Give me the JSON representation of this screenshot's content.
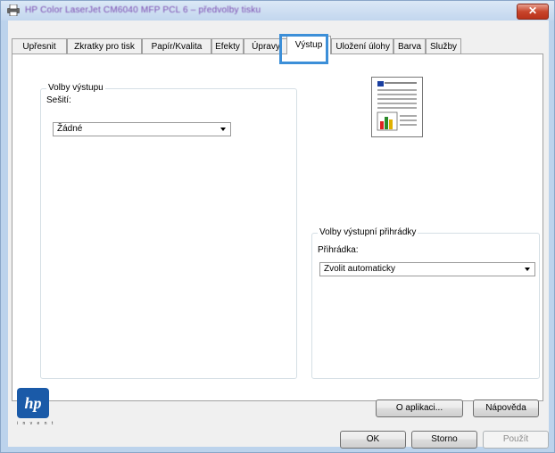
{
  "window": {
    "title": "HP Color LaserJet CM6040 MFP PCL 6 – předvolby tisku",
    "close_glyph": "✕"
  },
  "tabs": [
    {
      "label": "Upřesnit"
    },
    {
      "label": "Zkratky pro tisk"
    },
    {
      "label": "Papír/Kvalita"
    },
    {
      "label": "Efekty"
    },
    {
      "label": "Úpravy"
    },
    {
      "label": "Výstup"
    },
    {
      "label": "Uložení úlohy"
    },
    {
      "label": "Barva"
    },
    {
      "label": "Služby"
    }
  ],
  "active_tab": "Výstup",
  "output_options": {
    "legend": "Volby výstupu",
    "stapler_label": "Sešití:",
    "stapler_value": "Žádné"
  },
  "tray_options": {
    "legend": "Volby výstupní přihrádky",
    "tray_label": "Přihrádka:",
    "tray_value": "Zvolit automaticky"
  },
  "logo": {
    "tagline": "i n v e n t"
  },
  "buttons": {
    "about": "O aplikaci...",
    "help": "Nápověda",
    "ok": "OK",
    "cancel": "Storno",
    "apply": "Použít"
  },
  "colors": {
    "highlight": "#3c8fd8",
    "hp_blue": "#1a5aa8"
  }
}
